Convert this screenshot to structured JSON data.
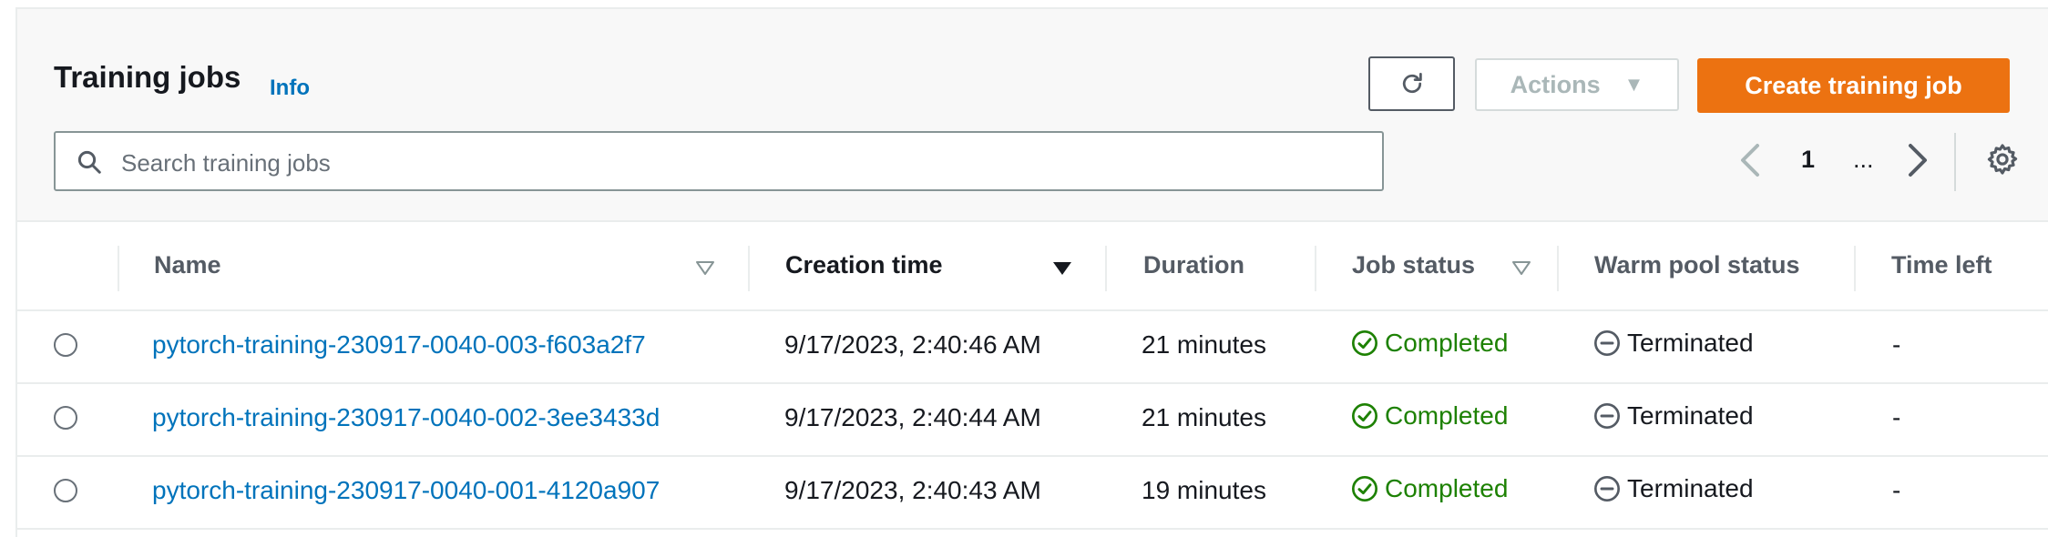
{
  "header": {
    "title": "Training jobs",
    "info_label": "Info",
    "actions_label": "Actions",
    "create_label": "Create training job",
    "search": {
      "placeholder": "Search training jobs",
      "value": ""
    },
    "pagination": {
      "current_page": "1",
      "ellipsis": "..."
    }
  },
  "table": {
    "columns": [
      "Name",
      "Creation time",
      "Duration",
      "Job status",
      "Warm pool status",
      "Time left"
    ],
    "rows": [
      {
        "name": "pytorch-training-230917-0040-003-f603a2f7",
        "creation_time": "9/17/2023, 2:40:46 AM",
        "duration": "21 minutes",
        "job_status": "Completed",
        "warm_pool_status": "Terminated",
        "time_left": "-"
      },
      {
        "name": "pytorch-training-230917-0040-002-3ee3433d",
        "creation_time": "9/17/2023, 2:40:44 AM",
        "duration": "21 minutes",
        "job_status": "Completed",
        "warm_pool_status": "Terminated",
        "time_left": "-"
      },
      {
        "name": "pytorch-training-230917-0040-001-4120a907",
        "creation_time": "9/17/2023, 2:40:43 AM",
        "duration": "19 minutes",
        "job_status": "Completed",
        "warm_pool_status": "Terminated",
        "time_left": "-"
      }
    ]
  },
  "icons": {
    "refresh": "refresh-icon",
    "search": "search-icon",
    "dropdown": "caret-down-icon",
    "prev": "chevron-left-icon",
    "next": "chevron-right-icon",
    "settings": "gear-icon",
    "completed": "check-circle-icon",
    "terminated": "minus-circle-icon"
  },
  "colors": {
    "primary_button": "#ec7211",
    "link": "#0073bb",
    "success": "#1d8102",
    "header_bg": "#f8f8f8"
  }
}
